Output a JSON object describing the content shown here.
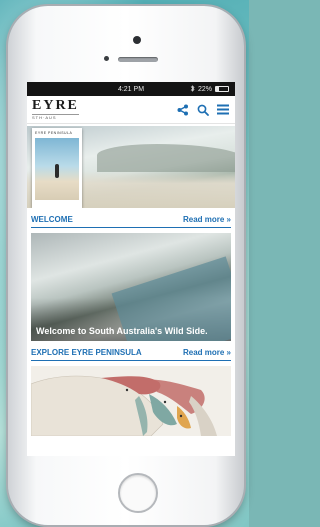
{
  "status_bar": {
    "time": "4:21 PM",
    "bluetooth": "bluetooth-icon",
    "battery_text": "22%",
    "battery_level": 0.22
  },
  "header": {
    "logo_title": "EYRE",
    "logo_subtitle": "STH·AUS",
    "icons": [
      "share-icon",
      "search-icon",
      "menu-icon"
    ]
  },
  "hero": {
    "magazine_title": "EYRE PENINSULA"
  },
  "welcome": {
    "title": "WELCOME",
    "more": "Read more »",
    "caption": "Welcome to South Australia's Wild Side."
  },
  "explore": {
    "title": "EXPLORE EYRE PENINSULA",
    "more": "Read more »"
  },
  "colors": {
    "accent": "#1e6fb3",
    "statusbar": "#141414",
    "map_region_red": "#c26d6a",
    "map_region_teal": "#7fa8a3",
    "map_region_orange": "#e0a54f"
  }
}
